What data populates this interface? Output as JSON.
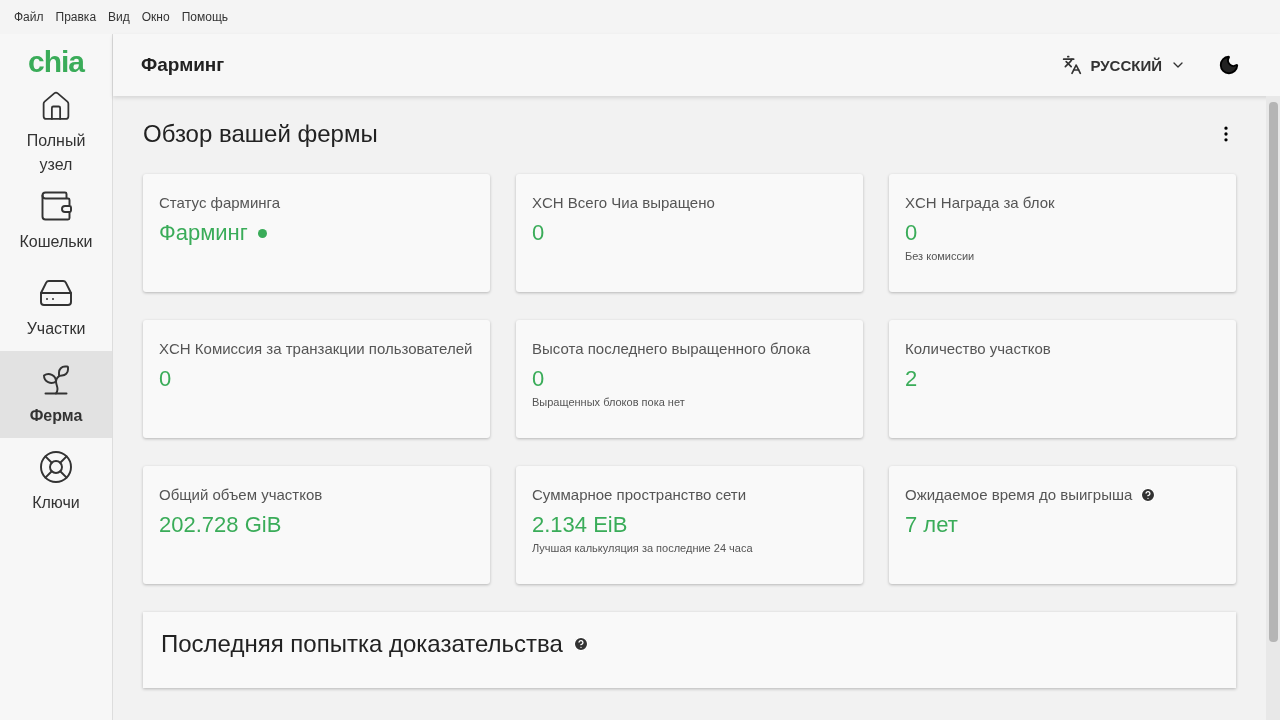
{
  "menu_bar": [
    "Файл",
    "Правка",
    "Вид",
    "Окно",
    "Помощь"
  ],
  "logo": "chia",
  "sidebar": {
    "items": [
      {
        "label": "Полный узел",
        "selected": false
      },
      {
        "label": "Кошельки",
        "selected": false
      },
      {
        "label": "Участки",
        "selected": false
      },
      {
        "label": "Ферма",
        "selected": true
      },
      {
        "label": "Ключи",
        "selected": false
      }
    ]
  },
  "header": {
    "title": "Фарминг",
    "language": "РУССКИЙ"
  },
  "overview": {
    "title": "Обзор вашей фермы",
    "cards": [
      {
        "label": "Статус фарминга",
        "value": "Фарминг",
        "status_dot": true
      },
      {
        "label": "XCH Всего Чиа выращено",
        "value": "0"
      },
      {
        "label": "XCH Награда за блок",
        "value": "0",
        "note": "Без комиссии"
      },
      {
        "label": "XCH Комиссия за транзакции пользователей",
        "value": "0"
      },
      {
        "label": "Высота последнего выращенного блока",
        "value": "0",
        "note": "Выращенных блоков пока нет"
      },
      {
        "label": "Количество участков",
        "value": "2"
      },
      {
        "label": "Общий объем участков",
        "value": "202.728 GiB"
      },
      {
        "label": "Суммарное пространство сети",
        "value": "2.134 EiB",
        "note": "Лучшая калькуляция за последние 24 часа"
      },
      {
        "label": "Ожидаемое время до выигрыша",
        "value": "7 лет",
        "help": true
      }
    ]
  },
  "proof_section": {
    "title": "Последняя попытка доказательства",
    "help": true
  }
}
